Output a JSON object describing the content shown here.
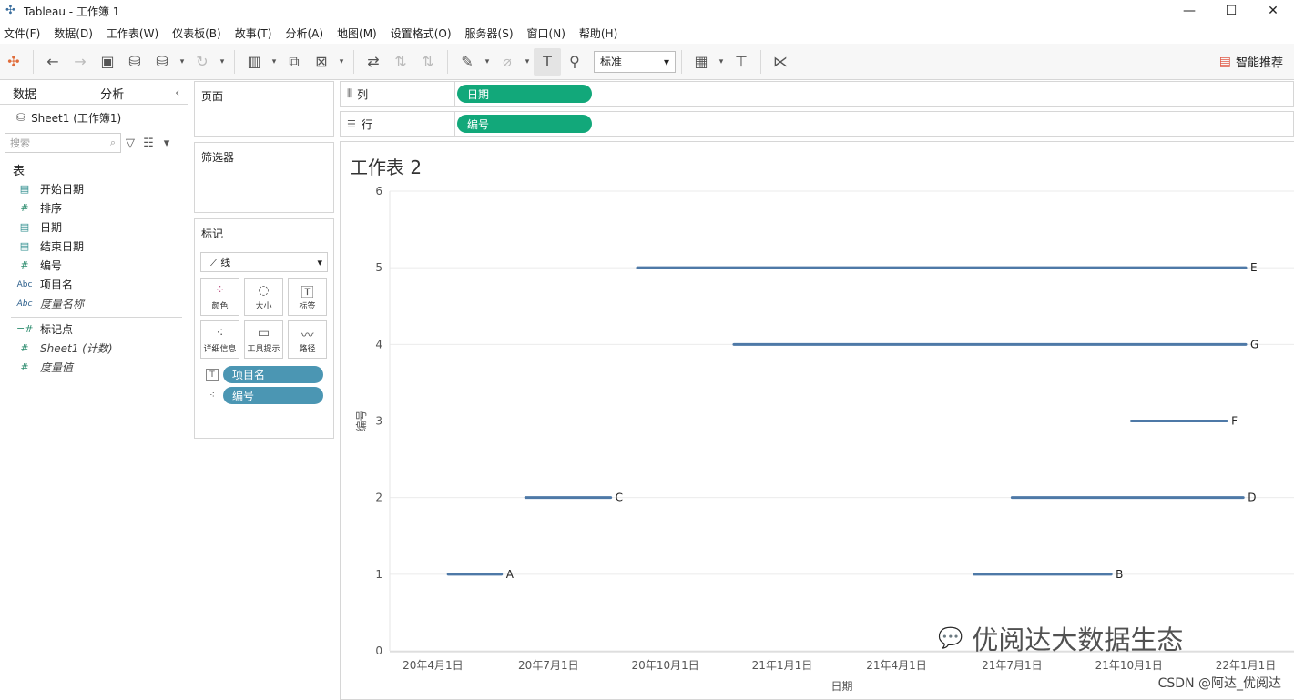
{
  "window": {
    "title": "Tableau - 工作簿 1",
    "logo": "tableau-logo-icon",
    "buttons": [
      "—",
      "☐",
      "✕"
    ]
  },
  "menu": [
    "文件(F)",
    "数据(D)",
    "工作表(W)",
    "仪表板(B)",
    "故事(T)",
    "分析(A)",
    "地图(M)",
    "设置格式(O)",
    "服务器(S)",
    "窗口(N)",
    "帮助(H)"
  ],
  "toolbar": {
    "fit_value": "标准",
    "smart_label": "智能推荐"
  },
  "left": {
    "tab_data": "数据",
    "tab_analysis": "分析",
    "source": "Sheet1 (工作簿1)",
    "search_placeholder": "搜索",
    "section": "表",
    "fields": [
      {
        "label": "开始日期",
        "icon": "calendar-icon"
      },
      {
        "label": "排序",
        "icon": "measure-icon"
      },
      {
        "label": "日期",
        "icon": "calendar-icon"
      },
      {
        "label": "结束日期",
        "icon": "calendar-icon"
      },
      {
        "label": "编号",
        "icon": "measure-icon"
      },
      {
        "label": "项目名",
        "icon": "abc-icon"
      },
      {
        "label": "度量名称",
        "icon": "abc-icon"
      }
    ],
    "measures": [
      {
        "label": "标记点",
        "icon": "measure-icon"
      },
      {
        "label": "Sheet1 (计数)",
        "icon": "measure-icon"
      },
      {
        "label": "度量值",
        "icon": "measure-icon"
      }
    ]
  },
  "cards": {
    "pages": "页面",
    "filters": "筛选器",
    "marks": "标记",
    "mark_type": "线",
    "buttons": [
      "颜色",
      "大小",
      "标签",
      "详细信息",
      "工具提示",
      "路径"
    ],
    "pill_label": "项目名",
    "pill_detail": "编号"
  },
  "shelves": {
    "columns_label": "列",
    "columns_pill": "日期",
    "rows_label": "行",
    "rows_pill": "编号"
  },
  "view": {
    "title": "工作表 2"
  },
  "chart_data": {
    "type": "line",
    "title": "工作表 2",
    "xlabel": "日期",
    "ylabel": "编号",
    "ylim": [
      0,
      6
    ],
    "yticks": [
      0,
      1,
      2,
      3,
      4,
      5,
      6
    ],
    "xticks": [
      "20年4月1日",
      "20年7月1日",
      "20年10月1日",
      "21年1月1日",
      "21年4月1日",
      "21年7月1日",
      "21年10月1日",
      "22年1月1日"
    ],
    "xlim": [
      "2020-02-27",
      "2022-02-08"
    ],
    "grid": "horizontal",
    "color": "#4e79a7",
    "series": [
      {
        "name": "A",
        "y": 1,
        "start": "2020-04-13",
        "end": "2020-05-25"
      },
      {
        "name": "B",
        "y": 1,
        "start": "2021-06-01",
        "end": "2021-09-17"
      },
      {
        "name": "C",
        "y": 2,
        "start": "2020-06-13",
        "end": "2020-08-19"
      },
      {
        "name": "D",
        "y": 2,
        "start": "2021-07-01",
        "end": "2021-12-30"
      },
      {
        "name": "E",
        "y": 5,
        "start": "2020-09-09",
        "end": "2022-01-01"
      },
      {
        "name": "F",
        "y": 3,
        "start": "2021-10-03",
        "end": "2021-12-17"
      },
      {
        "name": "G",
        "y": 4,
        "start": "2020-11-24",
        "end": "2022-01-01"
      }
    ]
  },
  "watermark": {
    "text": "优阅达大数据生态",
    "csdn": "CSDN @阿达_优阅达"
  }
}
